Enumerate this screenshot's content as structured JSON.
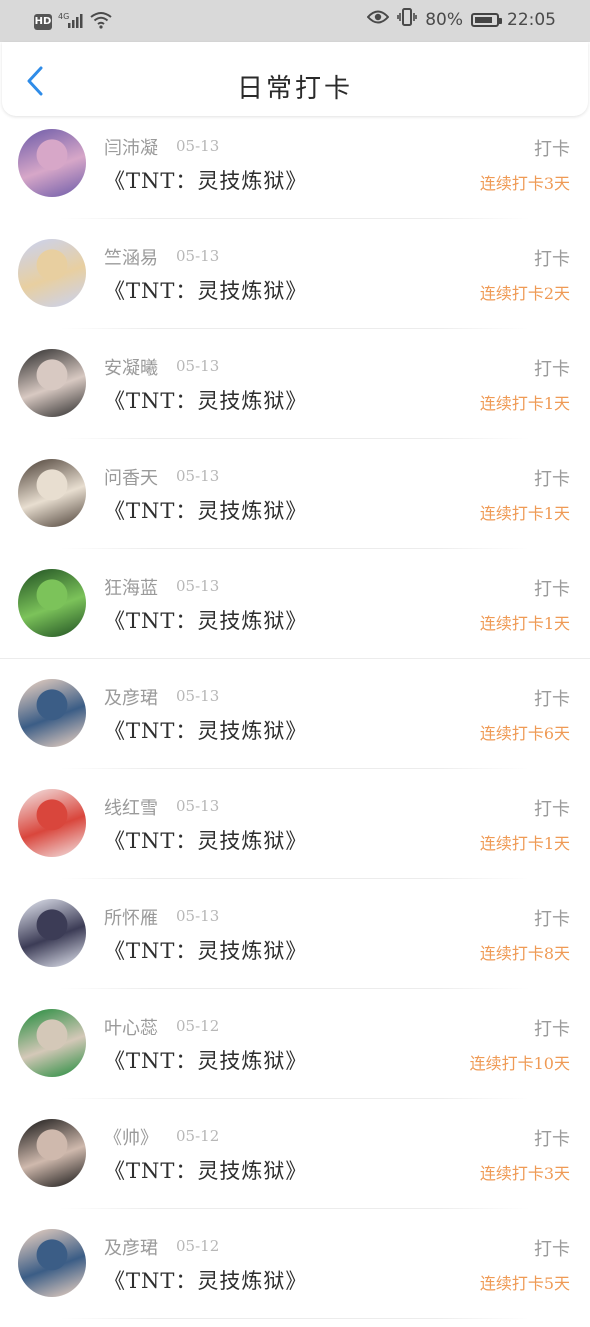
{
  "status_bar": {
    "hd": "HD",
    "network": "4G",
    "battery_percent": "80%",
    "time": "22:05"
  },
  "header": {
    "title": "日常打卡"
  },
  "items": [
    {
      "name": "闫沛凝",
      "date": "05-13",
      "book": "《TNT：灵技炼狱》",
      "action": "打卡",
      "streak": "连续打卡3天",
      "avatar_colors": [
        "#6b5aa8",
        "#d7a7c8"
      ]
    },
    {
      "name": "竺涵易",
      "date": "05-13",
      "book": "《TNT：灵技炼狱》",
      "action": "打卡",
      "streak": "连续打卡2天",
      "avatar_colors": [
        "#c9d2f2",
        "#e8cfa0"
      ]
    },
    {
      "name": "安凝曦",
      "date": "05-13",
      "book": "《TNT：灵技炼狱》",
      "action": "打卡",
      "streak": "连续打卡1天",
      "avatar_colors": [
        "#2a2a2a",
        "#d8c9c2"
      ]
    },
    {
      "name": "问香天",
      "date": "05-13",
      "book": "《TNT：灵技炼狱》",
      "action": "打卡",
      "streak": "连续打卡1天",
      "avatar_colors": [
        "#4b3f36",
        "#e8ded0"
      ]
    },
    {
      "name": "狂海蓝",
      "date": "05-13",
      "book": "《TNT：灵技炼狱》",
      "action": "打卡",
      "streak": "连续打卡1天",
      "avatar_colors": [
        "#1f4f22",
        "#7cc35a"
      ]
    },
    {
      "name": "及彦珺",
      "date": "05-13",
      "book": "《TNT：灵技炼狱》",
      "action": "打卡",
      "streak": "连续打卡6天",
      "avatar_colors": [
        "#f1d6c4",
        "#3b5d86"
      ]
    },
    {
      "name": "线红雪",
      "date": "05-13",
      "book": "《TNT：灵技炼狱》",
      "action": "打卡",
      "streak": "连续打卡1天",
      "avatar_colors": [
        "#f3e6e6",
        "#d9463c"
      ]
    },
    {
      "name": "所怀雁",
      "date": "05-13",
      "book": "《TNT：灵技炼狱》",
      "action": "打卡",
      "streak": "连续打卡8天",
      "avatar_colors": [
        "#e6e9f3",
        "#3c3c56"
      ]
    },
    {
      "name": "叶心蕊",
      "date": "05-12",
      "book": "《TNT：灵技炼狱》",
      "action": "打卡",
      "streak": "连续打卡10天",
      "avatar_colors": [
        "#1f8a3a",
        "#d4c8b8"
      ]
    },
    {
      "name": "《帅》",
      "date": "05-12",
      "book": "《TNT：灵技炼狱》",
      "action": "打卡",
      "streak": "连续打卡3天",
      "avatar_colors": [
        "#151515",
        "#cfb9ad"
      ]
    },
    {
      "name": "及彦珺",
      "date": "05-12",
      "book": "《TNT：灵技炼狱》",
      "action": "打卡",
      "streak": "连续打卡5天",
      "avatar_colors": [
        "#f1d6c4",
        "#3b5d86"
      ]
    }
  ]
}
